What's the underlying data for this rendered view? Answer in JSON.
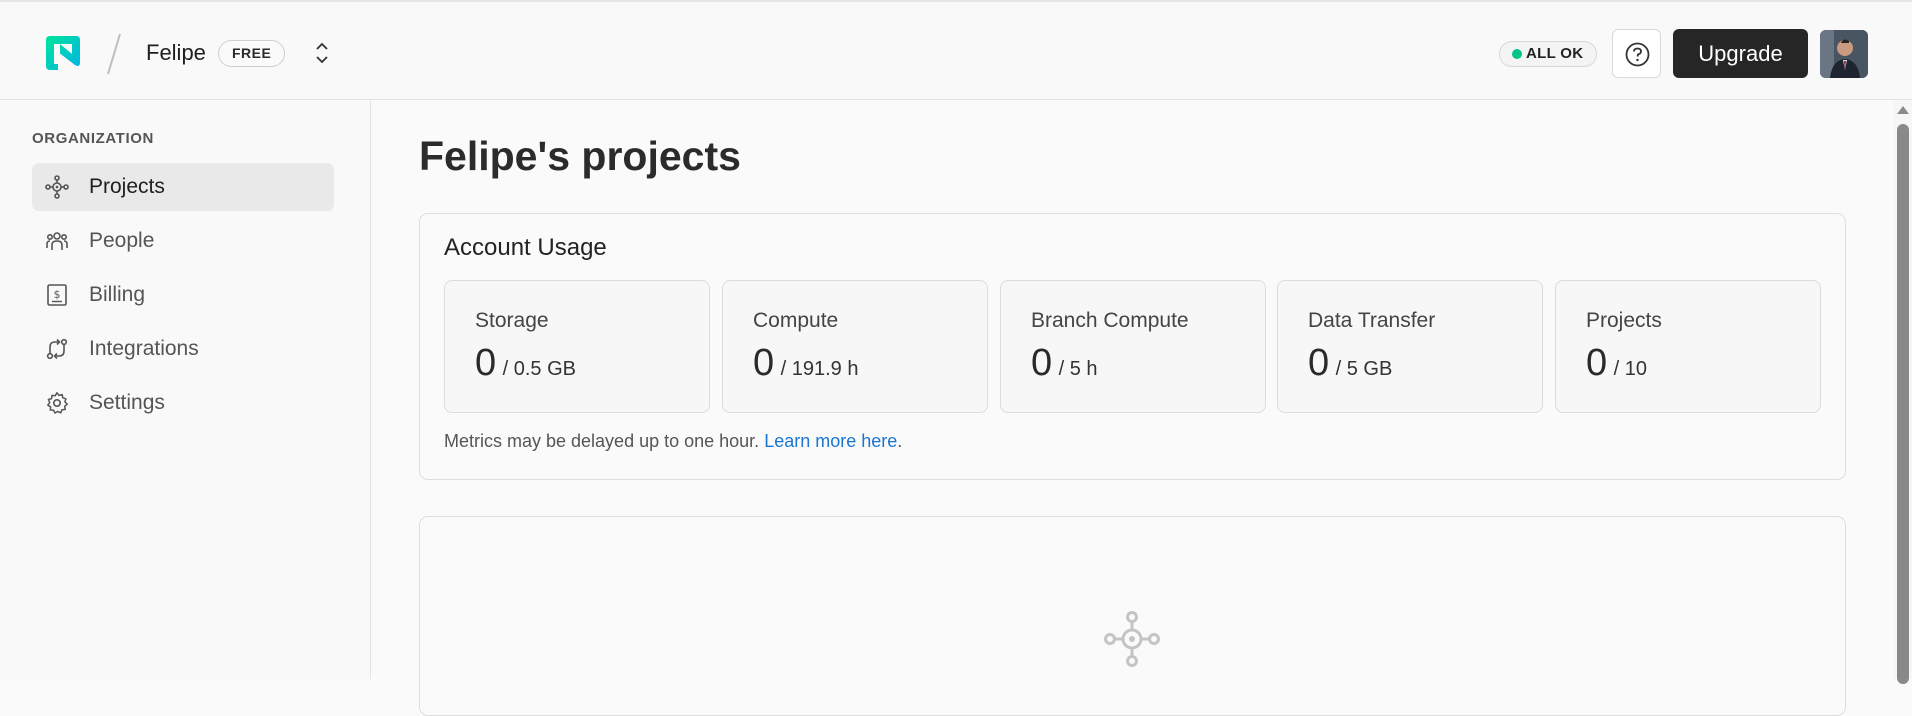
{
  "header": {
    "org_name": "Felipe",
    "plan_badge": "FREE",
    "status": "ALL OK",
    "upgrade_label": "Upgrade",
    "brand_color": "#00e599"
  },
  "sidebar": {
    "heading": "ORGANIZATION",
    "items": [
      {
        "label": "Projects",
        "icon": "projects-icon",
        "active": true
      },
      {
        "label": "People",
        "icon": "people-icon",
        "active": false
      },
      {
        "label": "Billing",
        "icon": "billing-icon",
        "active": false
      },
      {
        "label": "Integrations",
        "icon": "integrations-icon",
        "active": false
      },
      {
        "label": "Settings",
        "icon": "gear-icon",
        "active": false
      }
    ]
  },
  "main": {
    "title": "Felipe's projects",
    "usage": {
      "title": "Account Usage",
      "metrics": [
        {
          "label": "Storage",
          "used": "0",
          "limit": "/ 0.5 GB"
        },
        {
          "label": "Compute",
          "used": "0",
          "limit": "/ 191.9 h"
        },
        {
          "label": "Branch Compute",
          "used": "0",
          "limit": "/ 5 h"
        },
        {
          "label": "Data Transfer",
          "used": "0",
          "limit": "/ 5 GB"
        },
        {
          "label": "Projects",
          "used": "0",
          "limit": "/ 10"
        }
      ],
      "note_text": "Metrics may be delayed up to one hour.",
      "note_link": "Learn more here",
      "note_end": "."
    }
  }
}
